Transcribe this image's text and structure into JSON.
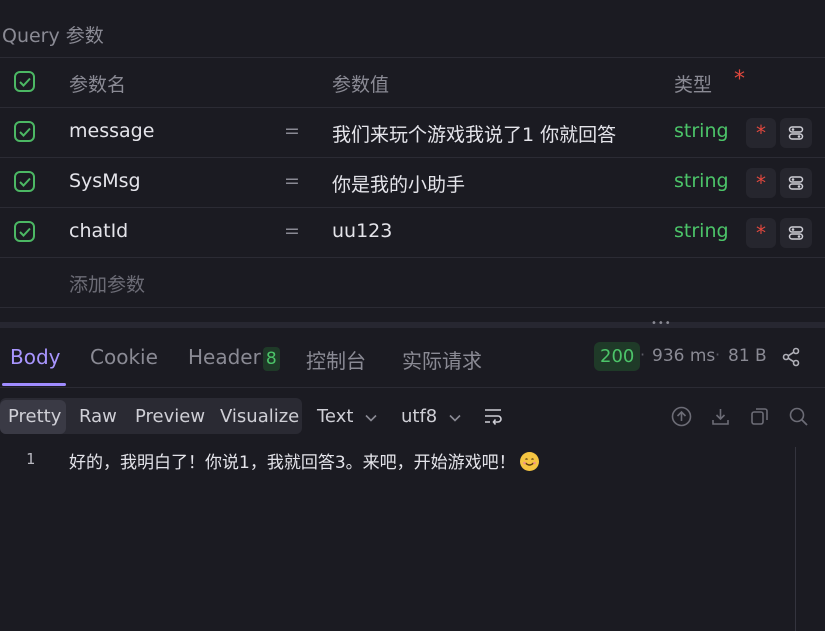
{
  "query_section": {
    "title": "Query 参数"
  },
  "params_table": {
    "header": {
      "name": "参数名",
      "value": "参数值",
      "type": "类型",
      "required_mark": "*"
    },
    "rows": [
      {
        "name": "message",
        "eq": "=",
        "value": "我们来玩个游戏我说了1 你就回答",
        "type": "string",
        "required": "*"
      },
      {
        "name": "SysMsg",
        "eq": "=",
        "value": "你是我的小助手",
        "type": "string",
        "required": "*"
      },
      {
        "name": "chatId",
        "eq": "=",
        "value": "uu123",
        "type": "string",
        "required": "*"
      }
    ],
    "add_placeholder": "添加参数"
  },
  "response_tabs": {
    "body": "Body",
    "cookie": "Cookie",
    "header": "Header",
    "header_count": "8",
    "console": "控制台",
    "actual_request": "实际请求"
  },
  "response_meta": {
    "status": "200",
    "time": "936 ms",
    "size": "81 B"
  },
  "view_modes": [
    "Pretty",
    "Raw",
    "Preview",
    "Visualize"
  ],
  "format": {
    "type": "Text",
    "encoding": "utf8"
  },
  "response_body": {
    "line_number": "1",
    "text": "好的，我明白了！你说1，我就回答3。来吧，开始游戏吧！"
  },
  "colors": {
    "accent": "#a996ff",
    "success": "#4cc469",
    "required": "#e0483e",
    "background": "#1b1b22"
  }
}
